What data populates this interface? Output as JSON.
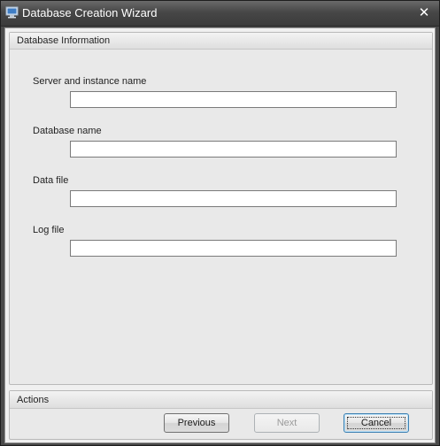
{
  "window": {
    "title": "Database Creation Wizard",
    "close_glyph": "✕"
  },
  "icons": {
    "app": "monitor-icon",
    "close": "close-icon"
  },
  "database_info": {
    "header": "Database Information",
    "fields": [
      {
        "label": "Server and instance name",
        "value": ""
      },
      {
        "label": "Database name",
        "value": ""
      },
      {
        "label": "Data file",
        "value": ""
      },
      {
        "label": "Log file",
        "value": ""
      }
    ]
  },
  "actions": {
    "header": "Actions",
    "previous_label": "Previous",
    "next_label": "Next",
    "cancel_label": "Cancel",
    "next_enabled": false,
    "default_button": "Cancel"
  },
  "colors": {
    "titlebar": "#474747",
    "panel": "#e9e9e9",
    "default_button_border": "#3c7fb1"
  }
}
